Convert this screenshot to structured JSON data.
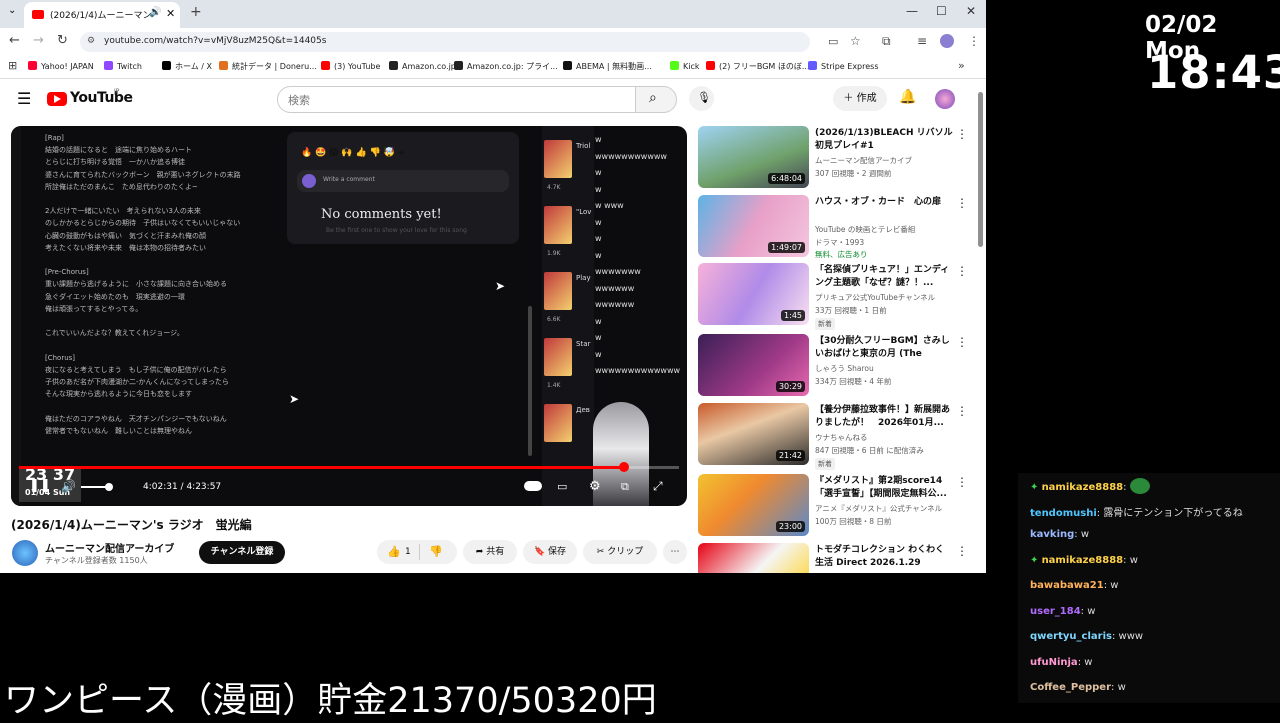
{
  "browser": {
    "tab_title": "(2026/1/4)ムーニーマン's ラジオ",
    "url": "youtube.com/watch?v=vMjV8uzM25Q&t=14405s",
    "bookmarks": [
      {
        "label": "Yahoo! JAPAN",
        "color": "#ff0033"
      },
      {
        "label": "Twitch",
        "color": "#9146ff"
      },
      {
        "label": "ホーム / X",
        "color": "#000000"
      },
      {
        "label": "統計データ | Doneru...",
        "color": "#e07020"
      },
      {
        "label": "(3) YouTube",
        "color": "#ff0000"
      },
      {
        "label": "Amazon.co.jp",
        "color": "#222222"
      },
      {
        "label": "Amazon.co.jp: プライ...",
        "color": "#222222"
      },
      {
        "label": "ABEMA | 無料動画...",
        "color": "#111111"
      },
      {
        "label": "Kick",
        "color": "#53fc18"
      },
      {
        "label": "(2) フリーBGM ほのぼ...",
        "color": "#ff0000"
      },
      {
        "label": "Stripe Express",
        "color": "#635bff"
      }
    ]
  },
  "youtube": {
    "logo": "YouTube",
    "logo_region": "JP",
    "search_placeholder": "検索",
    "create_label": "作成"
  },
  "player": {
    "lyrics_left": "[Rap]\n結婚の話題になると　途端に焦り始めるハート\nとらじに打ち明ける覚悟　一か八か追る博徒\n婆さんに育てられたバックボーン　親が悪いネグレクトの末路\n所詮俺はただのまんこ　ため息代わりのたくよ~\n\n2人だけで一緒にいたい　考えられない3人の未来\nのしかかるとらじからの期待　子供はいなくてもいいじゃない\n心臓の鼓動がもはや痛い　気づくと汗まみれ俺の顔\n考えたくない将来や未来　俺は本物の招待者みたい\n\n[Pre-Chorus]\n重い課題から逃げるように　小さな課題に向き合い始める\n急ぐダイエット始めたのも　現実逃避の一環\n俺は頑張ってするとやってる。\n\nこれでいいんだよな？教えてくれジョージ。\n\n[Chorus]\n夜になると考えてしまう　もし子供に俺の配信がバレたら\n子供のあだ名が下肉漫湖か二-かんくんになってしまったら\nそんな現実から逃れるように今日も恋をします\n\n俺はただのコアラやねん　天才チンパンジーでもないねん\n健常者でもないねん　難しいことは無理やねん",
    "emoji_reactions": "🔥 🤩 😱 🙌 👍 👎 🤯 +",
    "write_comment": "Write a comment",
    "no_comments": "No comments yet!",
    "be_first": "Be the first one to show your love for this song",
    "right_track_labels": [
      "Triol",
      "\"Lov",
      "Play",
      "Star",
      "Дев"
    ],
    "right_track_counts": [
      "4.7K",
      "1.9K",
      "6.6K",
      "1.4K",
      ""
    ],
    "chat_w_column": "w\nwwwwwwwwwww\nw\nw\nw www\nw\nw\nw\nwwwwwww\nwwwwww\nwwwwww\nw\nw\nw\nwwwwwwwwwwwww",
    "current_time": "4:02:31",
    "duration": "4:23:57",
    "time_display": "4:02:31 / 4:23:57",
    "progress_fraction": 0.917,
    "volume_fraction": 1.0,
    "overlay_clock": "23 37",
    "overlay_date": "01/04 Sun"
  },
  "video": {
    "title": "(2026/1/4)ムーニーマン's ラジオ　蛍光編",
    "channel_name": "ムーニーマン配信アーカイブ",
    "channel_subs": "チャンネル登録者数 1150人",
    "subscribe_label": "チャンネル登録",
    "like_count": "1",
    "share_label": "共有",
    "save_label": "保存",
    "clip_label": "クリップ"
  },
  "related": [
    {
      "title": "(2026/1/13)BLEACH リバソル 初見プレイ#1",
      "channel": "ムーニーマン配信アーカイブ",
      "meta": "307 回視聴・2 週間前",
      "duration": "6:48:04",
      "badge": "",
      "thumb": "linear-gradient(160deg,#9fd3f2,#6fa06a 60%,#445)"
    },
    {
      "title": "ハウス・オブ・カード　心の扉",
      "channel": "YouTube の映画とテレビ番組",
      "meta": "ドラマ・1993",
      "duration": "1:49:07",
      "badge": "無料、広告あり",
      "thumb": "linear-gradient(120deg,#5db3e6,#e8a0c8 50%,#f4c6de)"
    },
    {
      "title": "「名探偵プリキュア！」エンディング主題歌「なぜ？謎？！...",
      "channel": "プリキュア公式YouTubeチャンネル",
      "meta": "33万 回視聴・1 日前",
      "duration": "1:45",
      "badge": "新着",
      "thumb": "linear-gradient(120deg,#f7b1d9,#b08be8 50%,#f8e0f0)"
    },
    {
      "title": "【30分耐久フリーBGM】さみしいおばけと東京の月 (The lonel...",
      "channel": "しゃろう Sharou",
      "meta": "334万 回視聴・4 年前",
      "duration": "30:29",
      "badge": "",
      "thumb": "linear-gradient(135deg,#3a1f55,#a03a88 60%,#e86bb0)"
    },
    {
      "title": "【養分伊藤拉致事件！】新展開ありましたが！　2026年01月...",
      "channel": "ウナちゃんねる",
      "meta": "847 回視聴・6 日前 に配信済み",
      "duration": "21:42",
      "badge": "新着",
      "thumb": "linear-gradient(160deg,#c85a2a,#e9c8a4 40%,#2b2b2b)"
    },
    {
      "title": "『メダリスト』第2期score14「選手宣誓」【期間限定無料公...",
      "channel": "アニメ『メダリスト』公式チャンネル",
      "meta": "100万 回視聴・8 日前",
      "duration": "23:00",
      "badge": "",
      "thumb": "linear-gradient(135deg,#f2c230,#f08a30 40%,#5a8ac8)"
    },
    {
      "title": "トモダチコレクション わくわく生活 Direct 2026.1.29",
      "channel": "",
      "meta": "",
      "duration": "",
      "badge": "",
      "thumb": "linear-gradient(135deg,#e60012,#f5f5f5 50%,#ffcc00)"
    }
  ],
  "overlay": {
    "date": "02/02 Mon",
    "clock": "18:43",
    "savings": "ワンピース（漫画）貯金21370/50320円"
  },
  "chat": [
    {
      "user": "namikaze8888",
      "text": "",
      "color": "#ffd24a",
      "badge": true
    },
    {
      "user": "tendomushi",
      "text": "露骨にテンション下がってるね",
      "color": "#4dc6ff",
      "badge": false
    },
    {
      "user": "kavking",
      "text": "w",
      "color": "#9ab8ff",
      "badge": false
    },
    {
      "user": "namikaze8888",
      "text": "w",
      "color": "#ffd24a",
      "badge": true
    },
    {
      "user": "bawabawa21",
      "text": "w",
      "color": "#ffb35c",
      "badge": false
    },
    {
      "user": "user_184",
      "text": "w",
      "color": "#b36bff",
      "badge": false
    },
    {
      "user": "qwertyu_claris",
      "text": "www",
      "color": "#7fd6ff",
      "badge": false
    },
    {
      "user": "ufuNinja",
      "text": "w",
      "color": "#ff9ad2",
      "badge": false
    },
    {
      "user": "Coffee_Pepper",
      "text": "w",
      "color": "#e0c0a0",
      "badge": false
    }
  ]
}
